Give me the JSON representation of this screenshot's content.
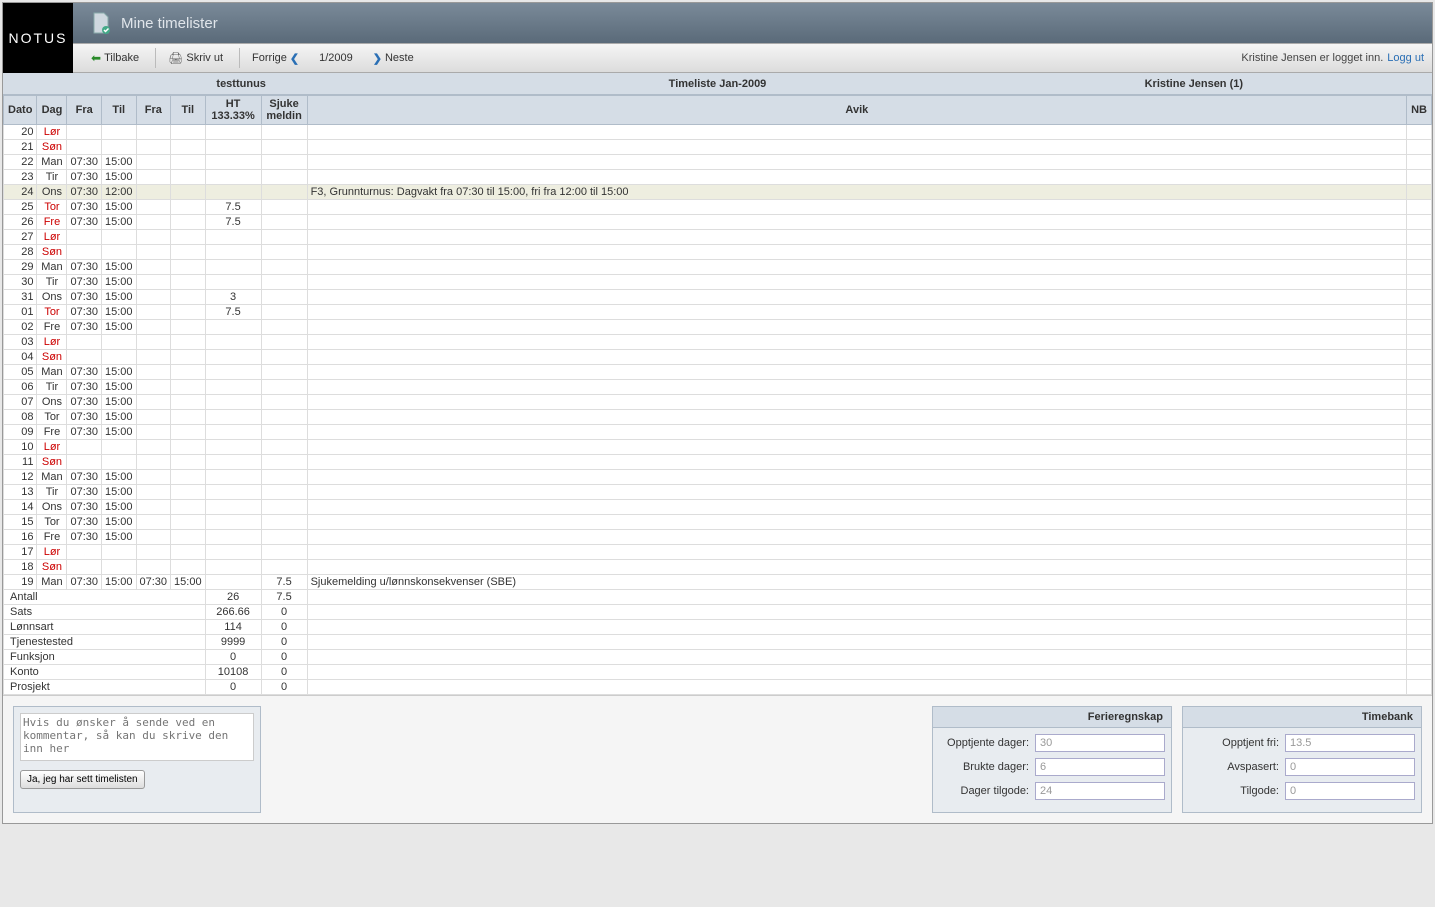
{
  "app": {
    "logo": "NOTUS",
    "title": "Mine timelister"
  },
  "toolbar": {
    "back": "Tilbake",
    "print": "Skriv ut",
    "prev": "Forrige",
    "period": "1/2009",
    "next": "Neste",
    "login_status": "Kristine Jensen er logget inn.",
    "logout": "Logg ut"
  },
  "subheader": {
    "left": "testtunus",
    "center": "Timeliste Jan-2009",
    "right": "Kristine Jensen (1)"
  },
  "columns": {
    "dato": "Dato",
    "dag": "Dag",
    "fra1": "Fra",
    "til1": "Til",
    "fra2": "Fra",
    "til2": "Til",
    "ht": "HT 133.33%",
    "sjuke": "Sjuke meldin",
    "avik": "Avik",
    "nb": "NB"
  },
  "rows": [
    {
      "dato": "20",
      "dag": "Lør",
      "weekend": true
    },
    {
      "dato": "21",
      "dag": "Søn",
      "weekend": true
    },
    {
      "dato": "22",
      "dag": "Man",
      "fra1": "07:30",
      "til1": "15:00"
    },
    {
      "dato": "23",
      "dag": "Tir",
      "fra1": "07:30",
      "til1": "15:00"
    },
    {
      "dato": "24",
      "dag": "Ons",
      "fra1": "07:30",
      "til1": "12:00",
      "avik": "F3, Grunnturnus: Dagvakt fra 07:30 til 15:00, fri fra 12:00 til 15:00",
      "highlight": true
    },
    {
      "dato": "25",
      "dag": "Tor",
      "weekend": true,
      "fra1": "07:30",
      "til1": "15:00",
      "ht": "7.5"
    },
    {
      "dato": "26",
      "dag": "Fre",
      "weekend": true,
      "fra1": "07:30",
      "til1": "15:00",
      "ht": "7.5"
    },
    {
      "dato": "27",
      "dag": "Lør",
      "weekend": true
    },
    {
      "dato": "28",
      "dag": "Søn",
      "weekend": true
    },
    {
      "dato": "29",
      "dag": "Man",
      "fra1": "07:30",
      "til1": "15:00"
    },
    {
      "dato": "30",
      "dag": "Tir",
      "fra1": "07:30",
      "til1": "15:00"
    },
    {
      "dato": "31",
      "dag": "Ons",
      "fra1": "07:30",
      "til1": "15:00",
      "ht": "3"
    },
    {
      "dato": "01",
      "dag": "Tor",
      "weekend": true,
      "fra1": "07:30",
      "til1": "15:00",
      "ht": "7.5"
    },
    {
      "dato": "02",
      "dag": "Fre",
      "fra1": "07:30",
      "til1": "15:00"
    },
    {
      "dato": "03",
      "dag": "Lør",
      "weekend": true
    },
    {
      "dato": "04",
      "dag": "Søn",
      "weekend": true
    },
    {
      "dato": "05",
      "dag": "Man",
      "fra1": "07:30",
      "til1": "15:00"
    },
    {
      "dato": "06",
      "dag": "Tir",
      "fra1": "07:30",
      "til1": "15:00"
    },
    {
      "dato": "07",
      "dag": "Ons",
      "fra1": "07:30",
      "til1": "15:00"
    },
    {
      "dato": "08",
      "dag": "Tor",
      "fra1": "07:30",
      "til1": "15:00"
    },
    {
      "dato": "09",
      "dag": "Fre",
      "fra1": "07:30",
      "til1": "15:00"
    },
    {
      "dato": "10",
      "dag": "Lør",
      "weekend": true
    },
    {
      "dato": "11",
      "dag": "Søn",
      "weekend": true
    },
    {
      "dato": "12",
      "dag": "Man",
      "fra1": "07:30",
      "til1": "15:00"
    },
    {
      "dato": "13",
      "dag": "Tir",
      "fra1": "07:30",
      "til1": "15:00"
    },
    {
      "dato": "14",
      "dag": "Ons",
      "fra1": "07:30",
      "til1": "15:00"
    },
    {
      "dato": "15",
      "dag": "Tor",
      "fra1": "07:30",
      "til1": "15:00"
    },
    {
      "dato": "16",
      "dag": "Fre",
      "fra1": "07:30",
      "til1": "15:00"
    },
    {
      "dato": "17",
      "dag": "Lør",
      "weekend": true
    },
    {
      "dato": "18",
      "dag": "Søn",
      "weekend": true
    },
    {
      "dato": "19",
      "dag": "Man",
      "fra1": "07:30",
      "til1": "15:00",
      "fra2": "07:30",
      "til2": "15:00",
      "sjuke": "7.5",
      "avik": "Sjukemelding u/lønnskonsekvenser (SBE)"
    }
  ],
  "summary_rows": [
    {
      "label": "Antall",
      "ht": "26",
      "sjuke": "7.5"
    },
    {
      "label": "Sats",
      "ht": "266.66",
      "sjuke": "0"
    },
    {
      "label": "Lønnsart",
      "ht": "114",
      "sjuke": "0"
    },
    {
      "label": "Tjenestested",
      "ht": "9999",
      "sjuke": "0"
    },
    {
      "label": "Funksjon",
      "ht": "0",
      "sjuke": "0"
    },
    {
      "label": "Konto",
      "ht": "10108",
      "sjuke": "0"
    },
    {
      "label": "Prosjekt",
      "ht": "0",
      "sjuke": "0"
    }
  ],
  "comment": {
    "placeholder": "Hvis du ønsker å sende ved en kommentar, så kan du skrive den inn her",
    "button": "Ja, jeg har sett timelisten"
  },
  "ferie": {
    "title": "Ferieregnskap",
    "opptjente_label": "Opptjente dager:",
    "opptjente": "30",
    "brukte_label": "Brukte dager:",
    "brukte": "6",
    "tilgode_label": "Dager tilgode:",
    "tilgode": "24"
  },
  "timebank": {
    "title": "Timebank",
    "opptjent_label": "Opptjent fri:",
    "opptjent": "13.5",
    "avspasert_label": "Avspasert:",
    "avspasert": "0",
    "tilgode_label": "Tilgode:",
    "tilgode": "0"
  }
}
